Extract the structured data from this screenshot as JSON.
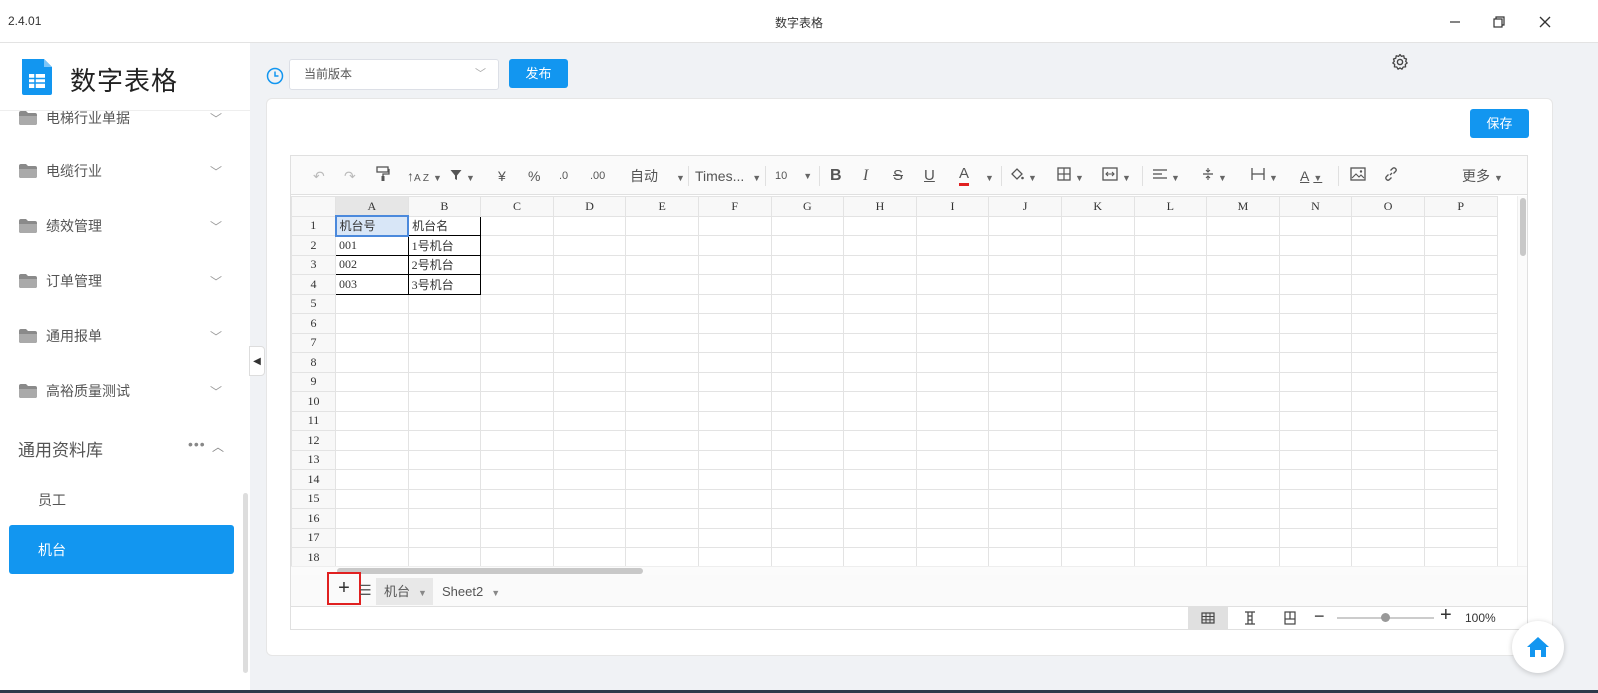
{
  "window": {
    "version": "2.4.01",
    "title": "数字表格"
  },
  "app": {
    "name": "数字表格"
  },
  "sidebar": {
    "partial_item": "电梯行业单据",
    "items": [
      {
        "label": "电缆行业"
      },
      {
        "label": "绩效管理"
      },
      {
        "label": "订单管理"
      },
      {
        "label": "通用报单"
      },
      {
        "label": "高裕质量测试"
      }
    ],
    "section": {
      "title": "通用资料库",
      "more": "•••"
    },
    "sub_items": [
      {
        "label": "员工"
      }
    ],
    "active_item": {
      "label": "机台"
    }
  },
  "topbar": {
    "version_select": "当前版本",
    "publish_label": "发布"
  },
  "panel": {
    "save_label": "保存"
  },
  "toolbar": {
    "currency": "¥",
    "percent": "%",
    "dec_inc": ".00",
    "dec_dec": ".0",
    "format": "自动",
    "font": "Times...",
    "size": "10",
    "bold": "B",
    "italic": "I",
    "strike": "S",
    "underline": "U",
    "font_color": "A",
    "text_color": "A",
    "more": "更多"
  },
  "sheet": {
    "columns": [
      "A",
      "B",
      "C",
      "D",
      "E",
      "F",
      "G",
      "H",
      "I",
      "J",
      "K",
      "L",
      "M",
      "N",
      "O",
      "P"
    ],
    "rows": [
      [
        "机台号",
        "机台名"
      ],
      [
        "001",
        "1号机台"
      ],
      [
        "002",
        "2号机台"
      ],
      [
        "003",
        "3号机台"
      ],
      [],
      [],
      [],
      [],
      [],
      [],
      [],
      [],
      [],
      [],
      [],
      [],
      [],
      []
    ],
    "row_numbers": [
      "1",
      "2",
      "3",
      "4",
      "5",
      "6",
      "7",
      "8",
      "9",
      "10",
      "11",
      "12",
      "13",
      "14",
      "15",
      "16",
      "17",
      "18"
    ]
  },
  "tabs": {
    "add": "+",
    "list": "☰",
    "sheets": [
      "机台",
      "Sheet2"
    ]
  },
  "status": {
    "zoom": "100%"
  },
  "colors": {
    "accent": "#1296f0",
    "highlight": "#e02020"
  }
}
